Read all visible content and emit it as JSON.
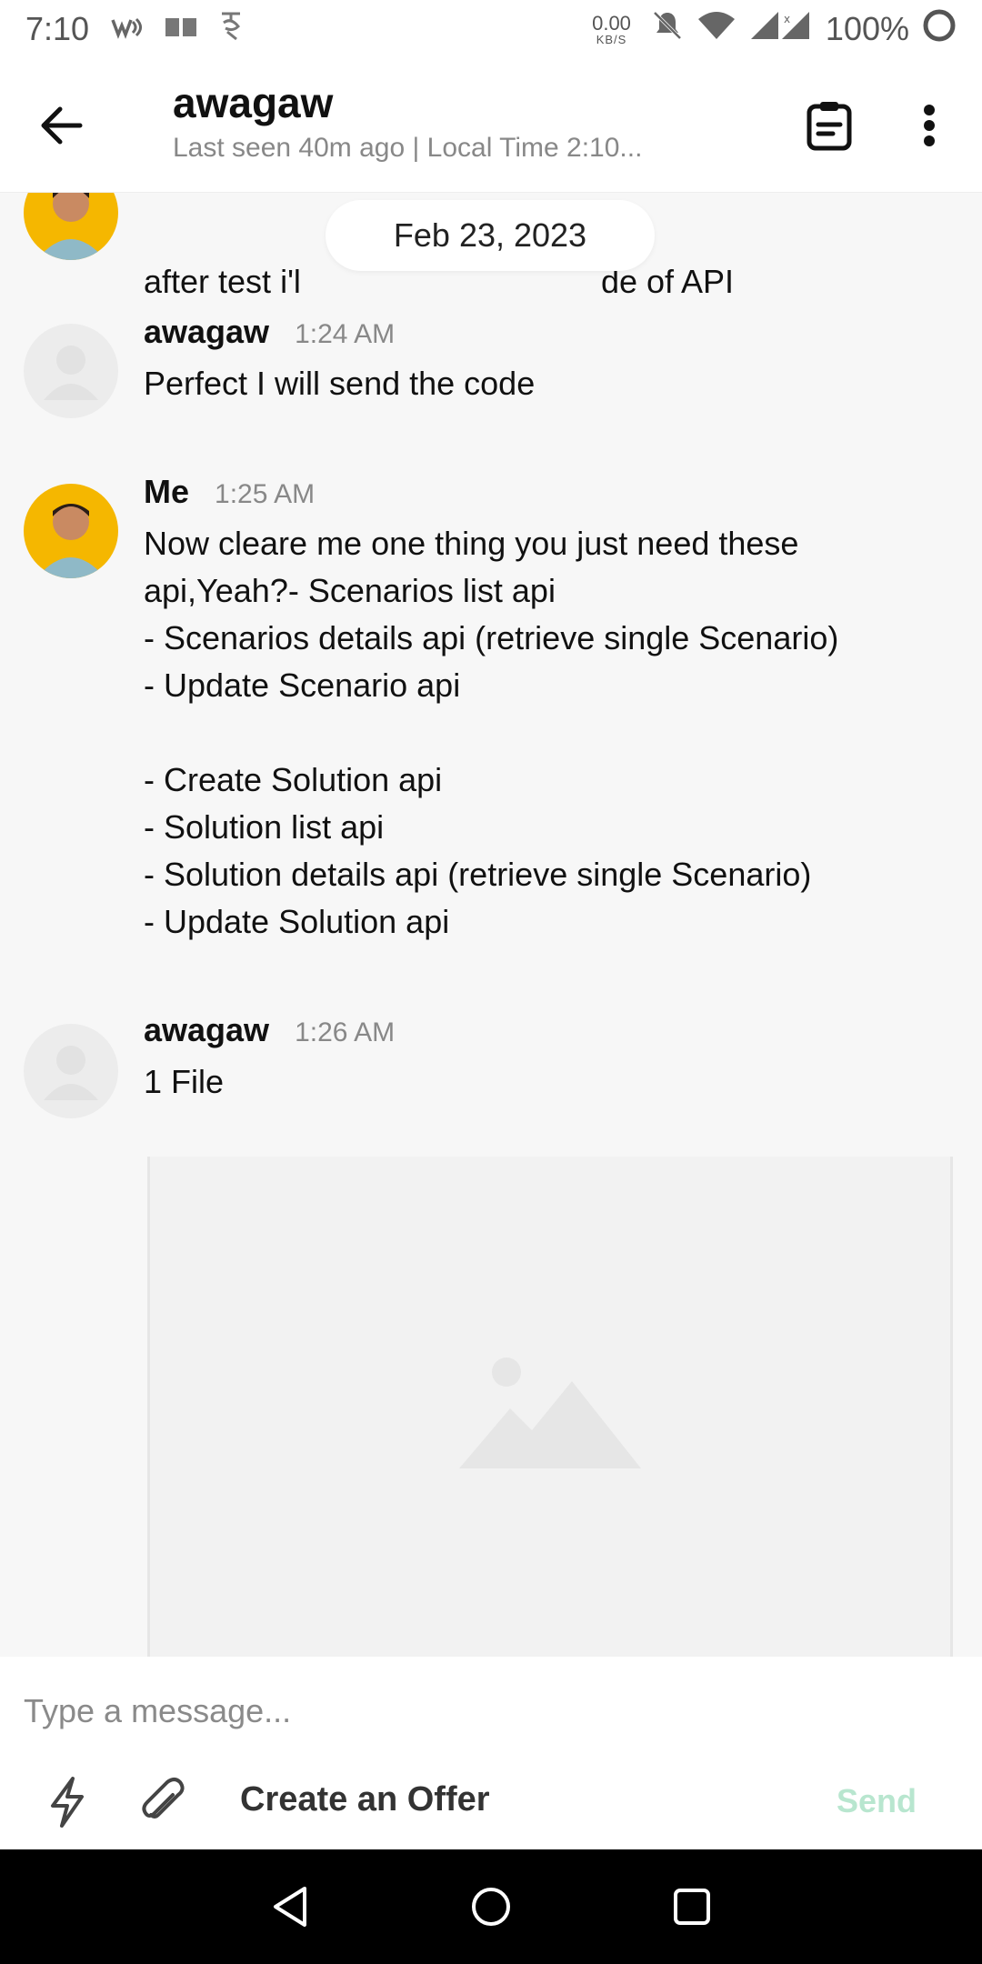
{
  "status_bar": {
    "time": "7:10",
    "net_speed": "0.00",
    "net_unit": "KB/S",
    "battery": "100%",
    "icons": [
      "wifi-call-icon",
      "book-icon",
      "signal-app-icon",
      "mute-icon",
      "wifi-icon",
      "cell-signal-icon",
      "battery-icon"
    ]
  },
  "header": {
    "name": "awagaw",
    "status": "Last seen 40m ago | Local Time 2:10..."
  },
  "chat": {
    "date_pill": "Feb 23, 2023",
    "partial_message": {
      "text_left": "after test i'l",
      "text_right": "de of API"
    },
    "messages": [
      {
        "sender": "awagaw",
        "time": "1:24 AM",
        "text": "Perfect I will send the code"
      },
      {
        "sender": "Me",
        "time": "1:25 AM",
        "text": "Now cleare me one thing you just need these\napi,Yeah?- Scenarios list api\n- Scenarios details api (retrieve single Scenario)\n- Update Scenario api\n\n- Create Solution api\n- Solution list api\n- Solution details api (retrieve single Scenario)\n- Update Solution api"
      },
      {
        "sender": "awagaw",
        "time": "1:26 AM",
        "text": "1 File"
      }
    ]
  },
  "composer": {
    "placeholder": "Type a message...",
    "create_offer_label": "Create an Offer",
    "send_label": "Send"
  },
  "colors": {
    "accent_send_disabled": "#b8e6cf",
    "me_avatar_bg": "#f5b700",
    "scroll_button": "#6f6f6f"
  }
}
